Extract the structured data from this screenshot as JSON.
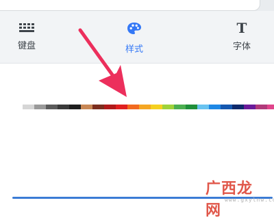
{
  "tabs": [
    {
      "label": "键盘",
      "icon": "keyboard-icon"
    },
    {
      "label": "样式",
      "icon": "palette-icon",
      "active": true
    },
    {
      "label": "字体",
      "icon": "font-icon"
    }
  ],
  "accent_color": "#3478f6",
  "palette": [
    "#ffffff",
    "#d6d6d6",
    "#9a9a9a",
    "#5b5b5b",
    "#3a3a3a",
    "#1e1e1e",
    "#c88755",
    "#7c2e1e",
    "#b11a1a",
    "#e02020",
    "#f26a1f",
    "#f5a623",
    "#f5d020",
    "#9fd23a",
    "#4caf50",
    "#1f8f3a",
    "#69c3f0",
    "#1e88e5",
    "#1558b0",
    "#0f2a6b",
    "#6a1b9a",
    "#b03a7a",
    "#e0458b"
  ],
  "watermark": {
    "title": "广西龙网",
    "url": "www.gxylnw.com"
  }
}
